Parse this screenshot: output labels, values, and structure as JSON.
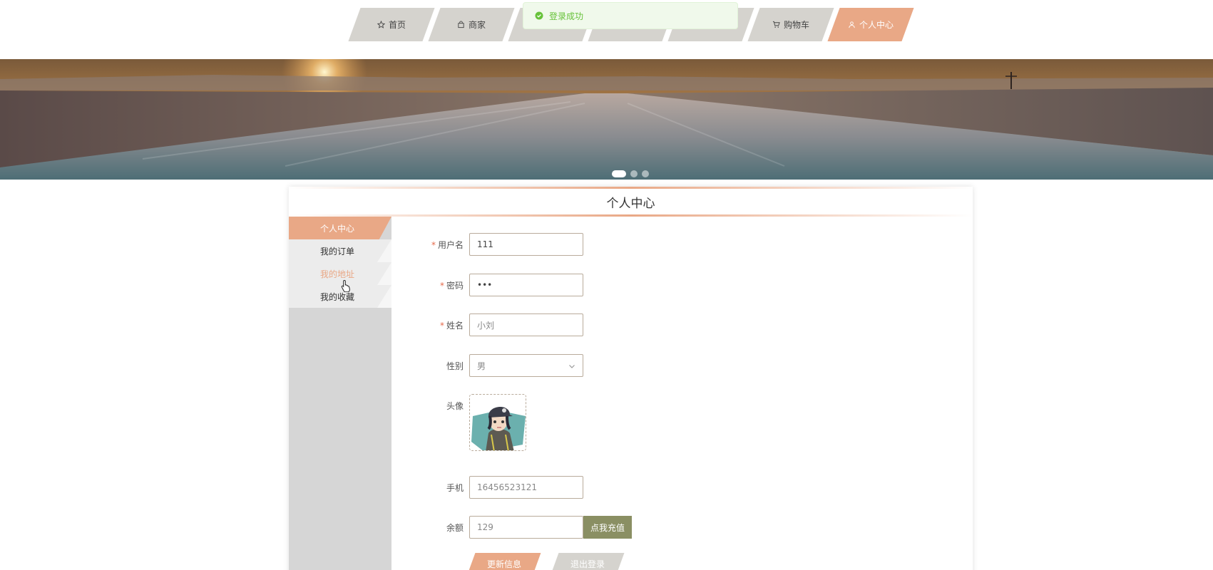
{
  "nav": {
    "items": [
      {
        "label": "首页",
        "icon": "star-icon"
      },
      {
        "label": "商家",
        "icon": "bag-icon"
      },
      {
        "label": "",
        "icon": ""
      },
      {
        "label": "",
        "icon": ""
      },
      {
        "label": "",
        "icon": ""
      },
      {
        "label": "购物车",
        "icon": "cart-icon"
      },
      {
        "label": "个人中心",
        "icon": "user-icon"
      }
    ],
    "active_index": 6
  },
  "toast": {
    "message": "登录成功",
    "color": "#67c23a"
  },
  "banner": {
    "slide_count": 3,
    "active_slide": 0
  },
  "card": {
    "title": "个人中心"
  },
  "sidebar": {
    "items": [
      {
        "label": "个人中心"
      },
      {
        "label": "我的订单"
      },
      {
        "label": "我的地址"
      },
      {
        "label": "我的收藏"
      }
    ]
  },
  "form": {
    "username": {
      "label": "用户名",
      "value": "111"
    },
    "password": {
      "label": "密码",
      "value": "•••"
    },
    "name": {
      "label": "姓名",
      "value": "小刘"
    },
    "gender": {
      "label": "性别",
      "value": "男"
    },
    "avatar": {
      "label": "头像"
    },
    "phone": {
      "label": "手机",
      "value": "16456523121"
    },
    "balance": {
      "label": "余额",
      "value": "129",
      "recharge_label": "点我充值"
    },
    "update_label": "更新信息",
    "logout_label": "退出登录",
    "required_mark": "*"
  },
  "colors": {
    "accent": "#e9a886",
    "nav_bg": "#d5d3ce",
    "recharge": "#8a8f63",
    "sidebar_bg": "#d6d6d6"
  }
}
